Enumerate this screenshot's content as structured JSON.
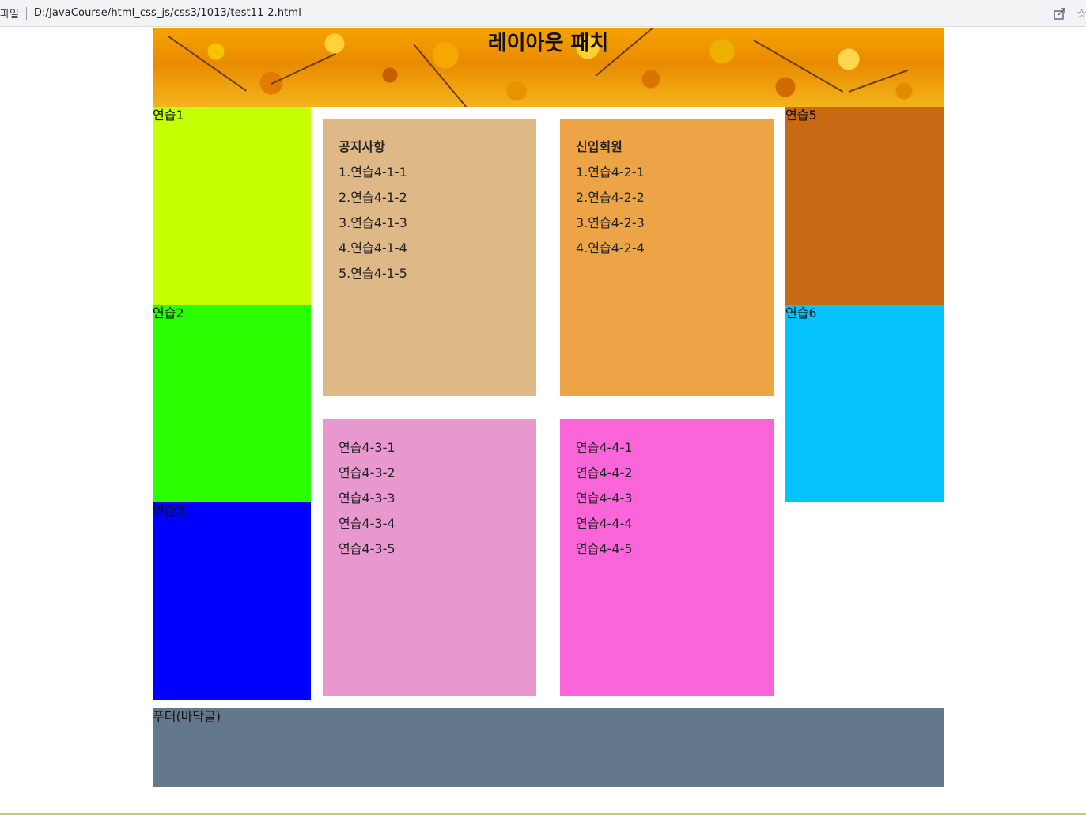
{
  "browser": {
    "protocol_label": "파일",
    "url": "D:/JavaCourse/html_css_js/css3/1013/test11-2.html"
  },
  "header": {
    "title": "레이아웃 패치"
  },
  "left_boxes": [
    {
      "label": "연습1",
      "color": "#c6ff00"
    },
    {
      "label": "연습2",
      "color": "#2aff00"
    },
    {
      "label": "연습3",
      "color": "#0000ff"
    }
  ],
  "right_boxes": [
    {
      "label": "연습5",
      "color": "#c76a13"
    },
    {
      "label": "연습6",
      "color": "#07c3fb"
    }
  ],
  "panels": [
    {
      "title": "공지사항",
      "color": "#deb887",
      "items": [
        "1.연습4-1-1",
        "2.연습4-1-2",
        "3.연습4-1-3",
        "4.연습4-1-4",
        "5.연습4-1-5"
      ]
    },
    {
      "title": "신입회원",
      "color": "#eca446",
      "items": [
        "1.연습4-2-1",
        "2.연습4-2-2",
        "3.연습4-2-3",
        "4.연습4-2-4"
      ]
    },
    {
      "title": "",
      "color": "#e898cf",
      "items": [
        "연습4-3-1",
        "연습4-3-2",
        "연습4-3-3",
        "연습4-3-4",
        "연습4-3-5"
      ]
    },
    {
      "title": "",
      "color": "#fa66d9",
      "items": [
        "연습4-4-1",
        "연습4-4-2",
        "연습4-4-3",
        "연습4-4-4",
        "연습4-4-5"
      ]
    }
  ],
  "footer": {
    "label": "푸터(바닥글)",
    "color": "#64788c"
  },
  "icons": {
    "share": "share-icon",
    "bookmark": "star-icon"
  }
}
